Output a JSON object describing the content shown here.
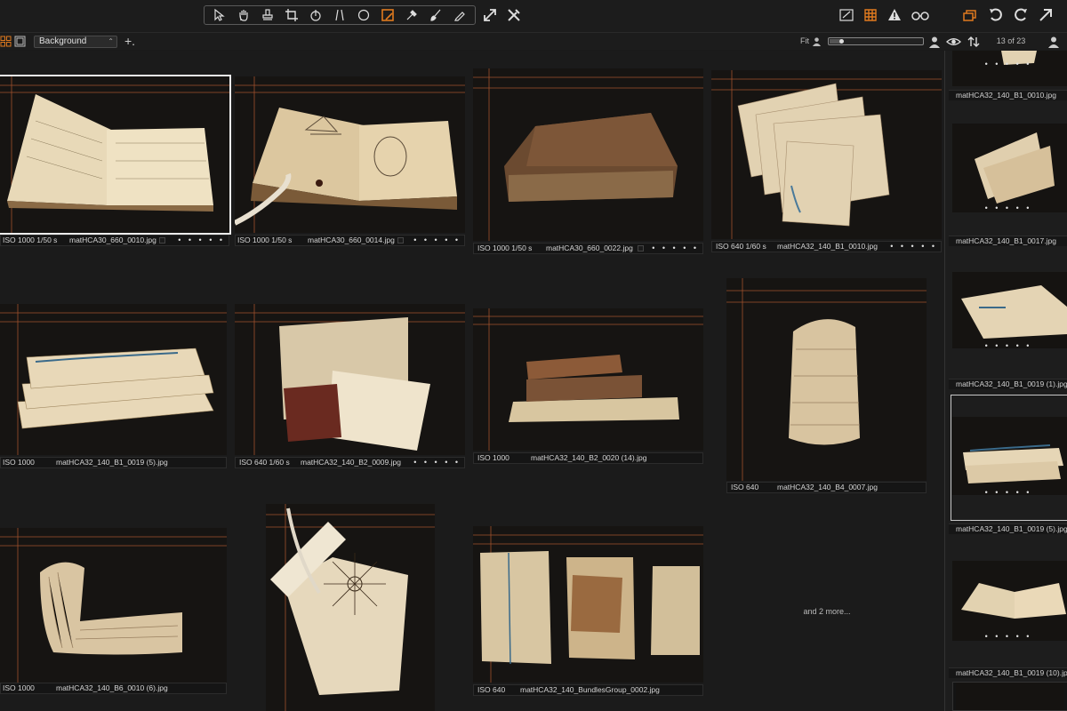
{
  "toolbar": {
    "tools": [
      "select-icon",
      "pan-icon",
      "stamp-icon",
      "crop-icon",
      "rotate-icon",
      "keystone-icon",
      "circle-icon",
      "mask-icon",
      "picker-icon",
      "brush-icon",
      "eraser-icon"
    ],
    "active_tool": "mask-icon",
    "accent": "#e07a1e"
  },
  "subbar": {
    "background_option": "Background",
    "add_label": "+.",
    "fit_label": "Fit",
    "zoom_level": 0.1,
    "count_label": "13 of 23"
  },
  "grid": {
    "cards": [
      {
        "iso": "ISO 1000 1/50 s",
        "file": "matHCA30_660_0010.jpg",
        "dots": "• • • • •",
        "selected": true,
        "tagged": true
      },
      {
        "iso": "ISO 1000 1/50 s",
        "file": "matHCA30_660_0014.jpg",
        "dots": "• • • • •",
        "selected": false,
        "tagged": true
      },
      {
        "iso": "ISO 1000 1/50 s",
        "file": "matHCA30_660_0022.jpg",
        "dots": "• • • • •",
        "selected": false,
        "tagged": true
      },
      {
        "iso": "ISO 640 1/60 s",
        "file": "matHCA32_140_B1_0010.jpg",
        "dots": "• • • • •",
        "selected": false,
        "tagged": false
      },
      {
        "iso": "ISO 1000",
        "file": "matHCA32_140_B1_0019 (5).jpg",
        "dots": "",
        "selected": false,
        "tagged": false
      },
      {
        "iso": "ISO 640 1/60 s",
        "file": "matHCA32_140_B2_0009.jpg",
        "dots": "• • • • •",
        "selected": false,
        "tagged": false
      },
      {
        "iso": "ISO 1000",
        "file": "matHCA32_140_B2_0020 (14).jpg",
        "dots": "",
        "selected": false,
        "tagged": false
      },
      {
        "iso": "ISO 640",
        "file": "matHCA32_140_B4_0007.jpg",
        "dots": "",
        "selected": false,
        "tagged": false
      },
      {
        "iso": "ISO 1000",
        "file": "matHCA32_140_B6_0010 (6).jpg",
        "dots": "",
        "selected": false,
        "tagged": false
      },
      {
        "iso": "",
        "file": "",
        "dots": "",
        "selected": false,
        "tagged": false
      },
      {
        "iso": "ISO 640",
        "file": "matHCA32_140_BundlesGroup_0002.jpg",
        "dots": "",
        "selected": false,
        "tagged": false
      }
    ],
    "more_label": "and 2 more..."
  },
  "strip": {
    "items": [
      {
        "label": "matHCA32_140_B1_0010.jpg",
        "dots": "• • • • •"
      },
      {
        "label": "matHCA32_140_B1_0017.jpg",
        "dots": "• • • • •"
      },
      {
        "label": "matHCA32_140_B1_0019 (1).jpg",
        "dots": "• • • • •"
      },
      {
        "label": "matHCA32_140_B1_0019 (5).jpg",
        "dots": "• • • • •"
      },
      {
        "label": "matHCA32_140_B1_0019 (10).jpg",
        "dots": "• • • • •"
      }
    ]
  }
}
